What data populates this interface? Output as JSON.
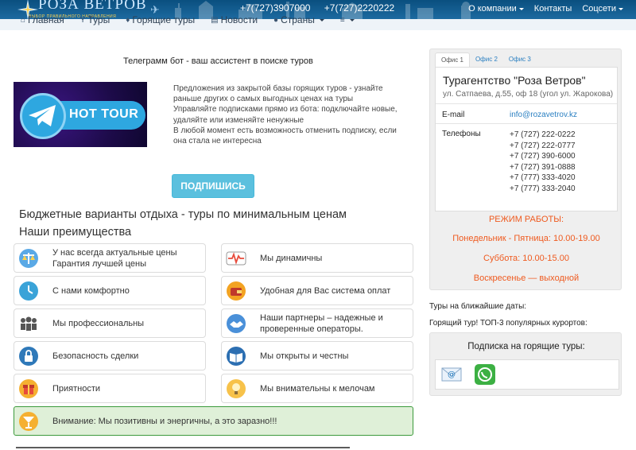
{
  "header": {
    "logo_text": "РОЗА ВЕТРОВ",
    "logo_sub": "ВЫБОР ПРАВИЛЬНОГО НАПРАВЛЕНИЯ",
    "phone1": "+7(727)3907000",
    "phone2": "+7(727)2220222",
    "nav": {
      "about": "О компании",
      "contacts": "Контакты",
      "socials": "Соцсети"
    }
  },
  "mainnav": {
    "items": [
      {
        "label": "Главная",
        "icon": "home-icon"
      },
      {
        "label": "Туры",
        "icon": "cocktail-icon"
      },
      {
        "label": "Горящие туры",
        "icon": "flame-icon"
      },
      {
        "label": "Новости",
        "icon": "newspaper-icon"
      },
      {
        "label": "Страны",
        "icon": "globe-icon"
      }
    ],
    "more_icon": "hamburger-icon"
  },
  "telegram": {
    "title": "Телеграмм бот - ваш ассистент в поиске туров",
    "banner_text": "HOT TOUR",
    "desc1": "Предложения из закрытой базы горящих туров - узнайте раньше других о самых выгодных ценах на туры",
    "desc2": "Управляйте подписками прямо из бота: подключайте новые, удаляйте или изменяйте ненужные",
    "desc3": "В любой момент есть возможность отменить подписку, если она стала не интересна",
    "subscribe_label": "ПОДПИШИСЬ"
  },
  "headings": {
    "budget": "Бюджетные варианты отдыха - туры по минимальным ценам",
    "advantages": "Наши преимущества"
  },
  "advantages": {
    "a1": "У нас всегда актуальные цены",
    "a1b": "Гарантия лучшей цены",
    "a2": "Мы динамичны",
    "a3": "С нами комфортно",
    "a4": "Удобная для Вас система оплат",
    "a5": "Мы профессиональны",
    "a6": "Наши партнеры – надежные и",
    "a6b": "проверенные операторы.",
    "a7": "Безопасность сделки",
    "a8": "Мы открыты и честны",
    "a9": "Приятности",
    "a10": "Мы внимательны к мелочам",
    "alert": "Внимание: Мы позитивны и энергичны, а это заразно!!!"
  },
  "office": {
    "tabs": [
      "Офис 1",
      "Офис 2",
      "Офис 3"
    ],
    "title": "Турагентство \"Роза Ветров\"",
    "address": "ул. Сатпаева, д.55, оф 18 (угол ул. Жарокова)",
    "email_label": "E-mail",
    "email": "info@rozavetrov.kz",
    "phones_label": "Телефоны",
    "phones": [
      "+7 (727) 222-0222",
      "+7 (727) 222-0777",
      "+7 (727) 390-6000",
      "+7 (727) 391-0888",
      "+7 (777) 333-4020",
      "+7 (777) 333-2040"
    ],
    "hours_title": "РЕЖИМ РАБОТЫ:",
    "hours_weekdays": "Понедельник - Пятница: 10.00-19.00",
    "hours_saturday": "Суббота: 10.00-15.00",
    "hours_sunday": "Воскресенье — выходной"
  },
  "right": {
    "near_dates": "Туры на ближайшие даты:",
    "hot_top": "Горящий тур! ТОП-3 популярных курортов:",
    "subscribe_title": "Подписка на горящие туры:",
    "icons": [
      "email-icon",
      "whatsapp-icon"
    ]
  },
  "colors": {
    "header_blue": "#0a4f7f",
    "accent_orange": "#ef5a1f",
    "button_blue": "#5bc0de",
    "alert_green": "#dff0d8",
    "link_blue": "#2a7fc1"
  }
}
